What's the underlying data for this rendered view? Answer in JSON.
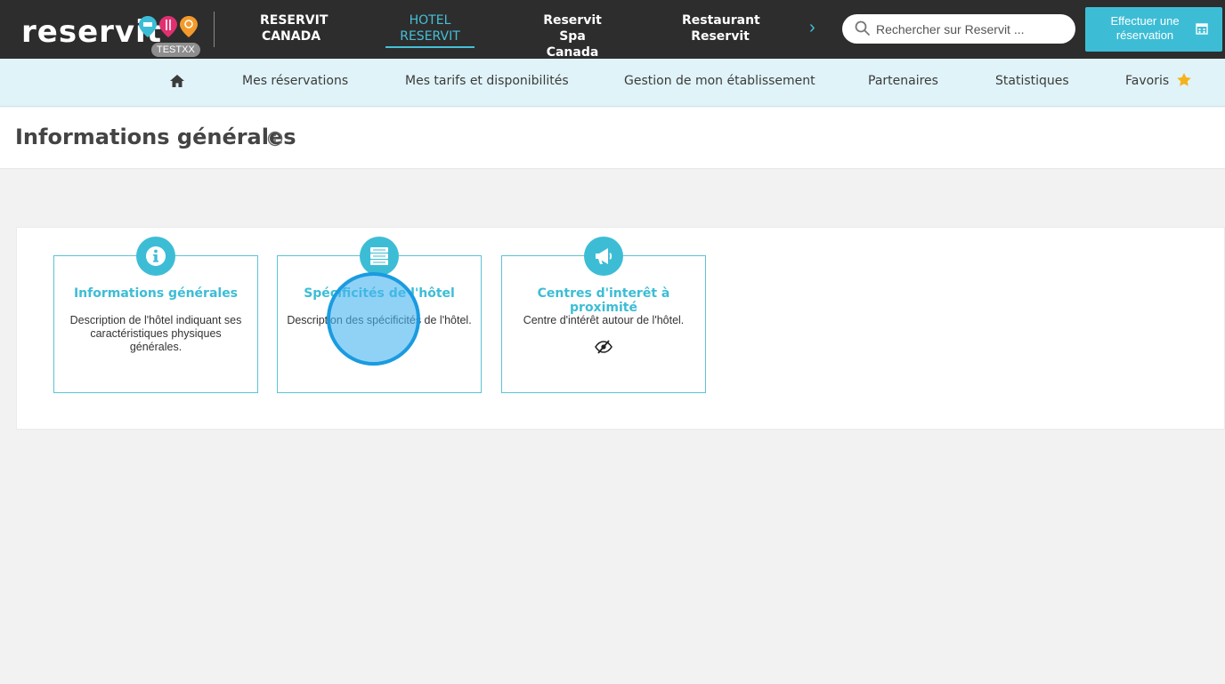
{
  "brand": {
    "logo_text": "reservit",
    "env_badge": "TESTXX",
    "pin_colors": [
      "#3dbdd5",
      "#e0306f",
      "#f39a2b"
    ]
  },
  "top_nav": {
    "tabs": [
      {
        "line1": "RESERVIT",
        "line2": "CANADA",
        "active": false
      },
      {
        "line1": "HOTEL",
        "line2": "RESERVIT",
        "active": true
      },
      {
        "line1": "Reservit Spa",
        "line2": "Canada",
        "active": false
      },
      {
        "line1": "Restaurant",
        "line2": "Reservit",
        "active": false
      }
    ],
    "next_glyph": "›"
  },
  "search": {
    "placeholder": "Rechercher sur Reservit ..."
  },
  "book_button": {
    "line1": "Effectuer une",
    "line2": "réservation"
  },
  "sub_nav": {
    "items": [
      "Mes réservations",
      "Mes tarifs et disponibilités",
      "Gestion de mon établissement",
      "Partenaires",
      "Statistiques",
      "Favoris"
    ]
  },
  "page": {
    "title": "Informations générales"
  },
  "cards": [
    {
      "icon": "info-icon",
      "title": "Informations générales",
      "description": "Description de l'hôtel indiquant ses caractéristiques physiques générales."
    },
    {
      "icon": "server-icon",
      "title": "Spécificités de l'hôtel",
      "description": "Description des spécificités de l'hôtel."
    },
    {
      "icon": "megaphone-icon",
      "title": "Centres d'interêt à proximité",
      "description": "Centre d'intérêt autour de l'hôtel."
    }
  ],
  "colors": {
    "accent": "#3dbdd5",
    "topbar": "#2d2d2d",
    "subbar": "#e0f3f8",
    "star": "#f5b21a"
  }
}
